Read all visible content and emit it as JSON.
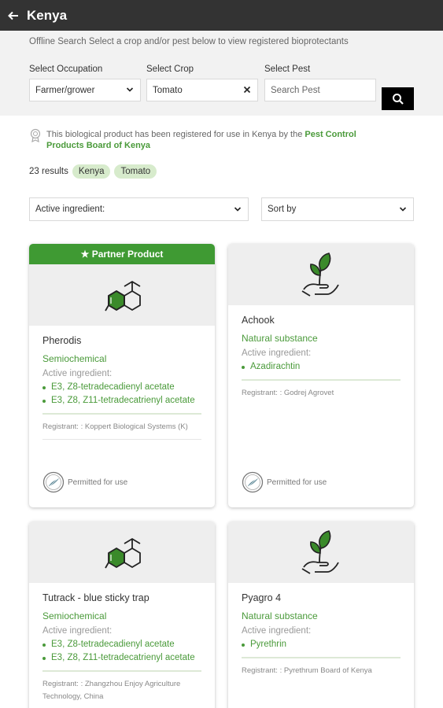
{
  "header": {
    "title": "Kenya",
    "back_icon": "arrow-left-icon"
  },
  "search": {
    "note": "Offline Search Select a crop and/or pest below to view registered bioprotectants",
    "occupation_label": "Select Occupation",
    "occupation_value": "Farmer/grower",
    "crop_label": "Select Crop",
    "crop_value": "Tomato",
    "pest_label": "Select Pest",
    "pest_placeholder": "Search Pest"
  },
  "notice": {
    "text": "This biological product has been registered for use in Kenya by the ",
    "link": "Pest Control Products Board of Kenya"
  },
  "results": {
    "count_text": "23 results",
    "chips": [
      "Kenya",
      "Tomato"
    ]
  },
  "filters": {
    "ingredient_label": "Active ingredient:",
    "sort_label": "Sort by"
  },
  "common": {
    "active_label": "Active ingredient:",
    "permitted": "Permitted for use",
    "partner": "★ Partner Product"
  },
  "products": [
    {
      "name": "Pherodis",
      "type": "Semiochemical",
      "ingredients": [
        "E3, Z8-tetradecadienyl acetate",
        "E3, Z8, Z11-tetradecatrienyl acetate"
      ],
      "registrant": "Registrant: : Koppert Biological Systems (K)"
    },
    {
      "name": "Achook",
      "type": "Natural substance",
      "ingredients": [
        "Azadirachtin"
      ],
      "registrant": "Registrant: : Godrej Agrovet"
    },
    {
      "name": "Tutrack - blue sticky trap",
      "type": "Semiochemical",
      "ingredients": [
        "E3, Z8-tetradecadienyl acetate",
        "E3, Z8, Z11-tetradecatrienyl acetate"
      ],
      "registrant": "Registrant: : Zhangzhou Enjoy Agriculture Technology, China"
    },
    {
      "name": "Pyagro 4",
      "type": "Natural substance",
      "ingredients": [
        "Pyrethrin"
      ],
      "registrant": "Registrant: : Pyrethrum Board of Kenya"
    }
  ],
  "colors": {
    "appbar": "#333333",
    "accent_green": "#4a9a3a",
    "partner_green": "#3f9a33",
    "chip": "#d7ebcc"
  }
}
